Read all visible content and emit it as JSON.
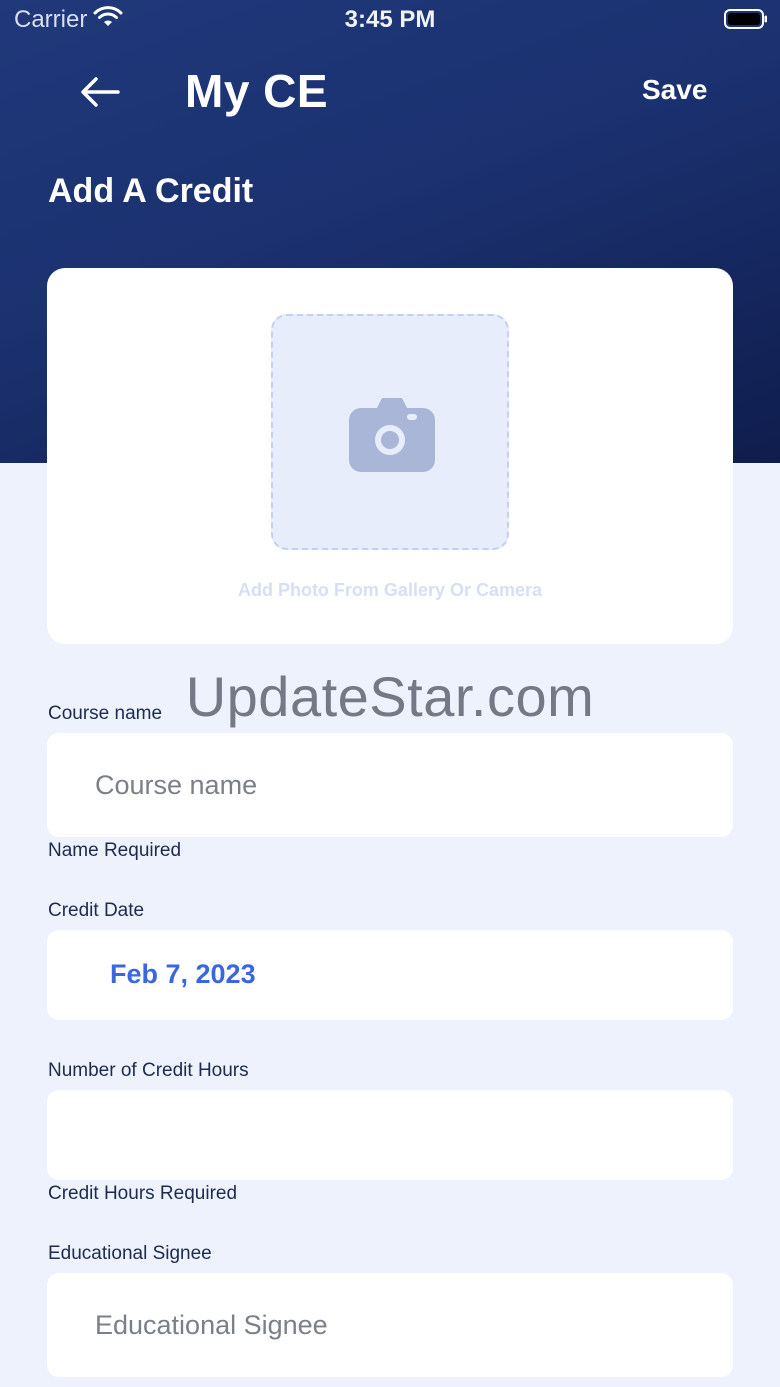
{
  "status_bar": {
    "carrier": "Carrier",
    "time": "3:45 PM",
    "icons": [
      "wifi-icon",
      "battery-icon"
    ]
  },
  "nav": {
    "back_icon": "arrow-left-icon",
    "title": "My CE",
    "save_label": "Save"
  },
  "section_title": "Add A Credit",
  "photo": {
    "icon": "camera-icon",
    "caption": "Add Photo From Gallery Or Camera"
  },
  "form": {
    "course_name": {
      "label": "Course name",
      "placeholder": "Course name",
      "value": "",
      "error": "Name Required"
    },
    "credit_date": {
      "label": "Credit Date",
      "value": "Feb 7, 2023"
    },
    "credit_hours": {
      "label": "Number of Credit Hours",
      "placeholder": "",
      "value": "",
      "error": "Credit Hours Required"
    },
    "educational_signee": {
      "label": "Educational Signee",
      "placeholder": "Educational Signee",
      "value": ""
    }
  },
  "watermark": "UpdateStar.com",
  "colors": {
    "header_gradient_top": "#20397a",
    "header_gradient_bottom": "#0f1d4d",
    "page_background": "#eef2fc",
    "accent_blue": "#3a66e0",
    "label_text": "#1d2b4f"
  }
}
